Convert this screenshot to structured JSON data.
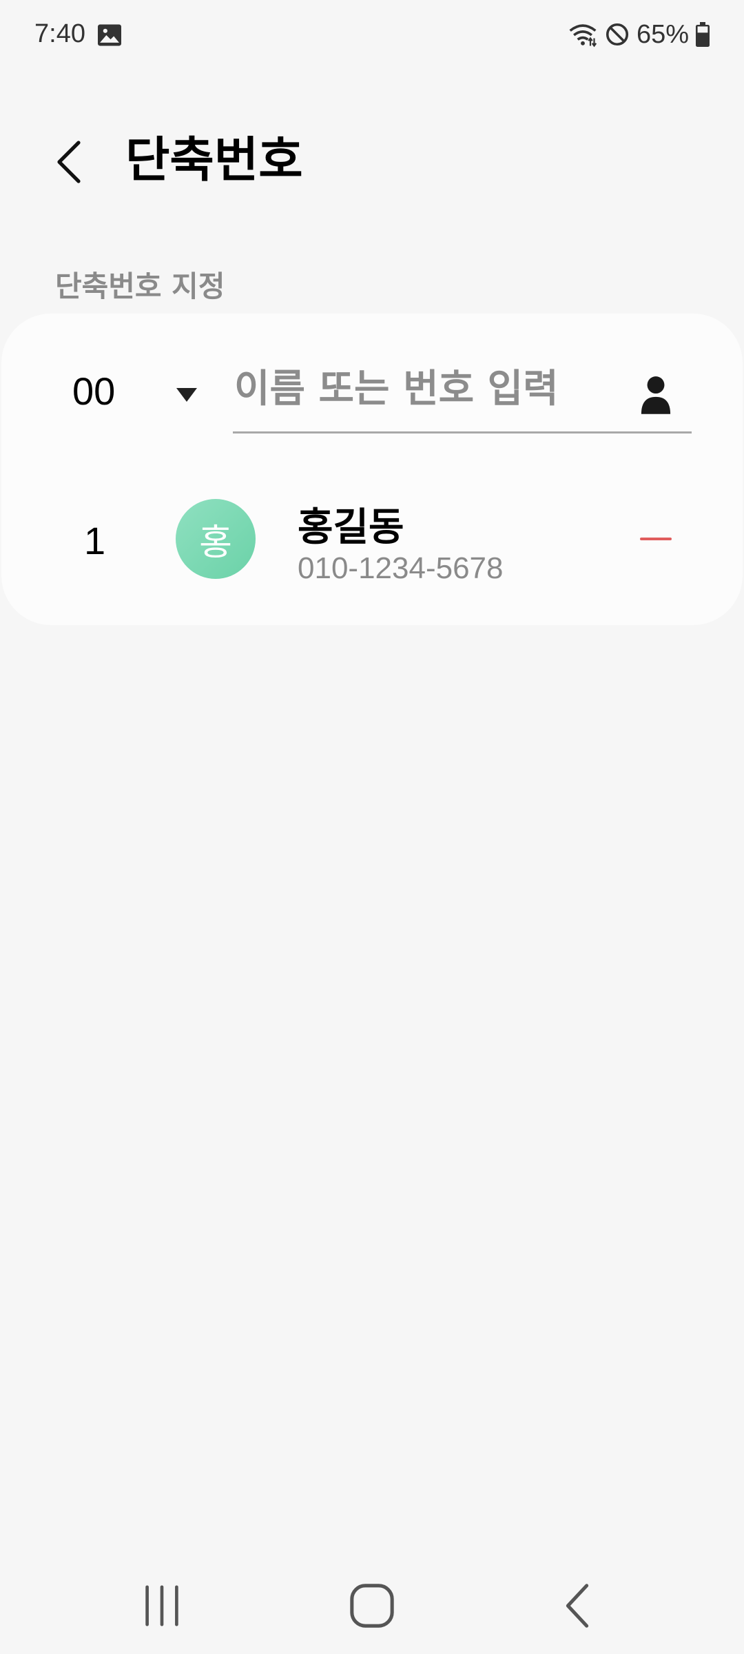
{
  "status_bar": {
    "time": "7:40",
    "battery": "65%",
    "icons": [
      "image-icon",
      "wifi-icon",
      "do-not-disturb-icon",
      "battery-icon"
    ]
  },
  "header": {
    "title": "단축번호"
  },
  "section": {
    "label": "단축번호 지정"
  },
  "assign": {
    "selected_number": "00",
    "search_placeholder": "이름 또는 번호 입력"
  },
  "entries": [
    {
      "number": "1",
      "avatar_letter": "홍",
      "name": "홍길동",
      "phone": "010-1234-5678"
    }
  ],
  "colors": {
    "background": "#f6f6f6",
    "card": "#fcfcfc",
    "avatar": "#7ed8b4",
    "remove": "#e05c5c"
  }
}
